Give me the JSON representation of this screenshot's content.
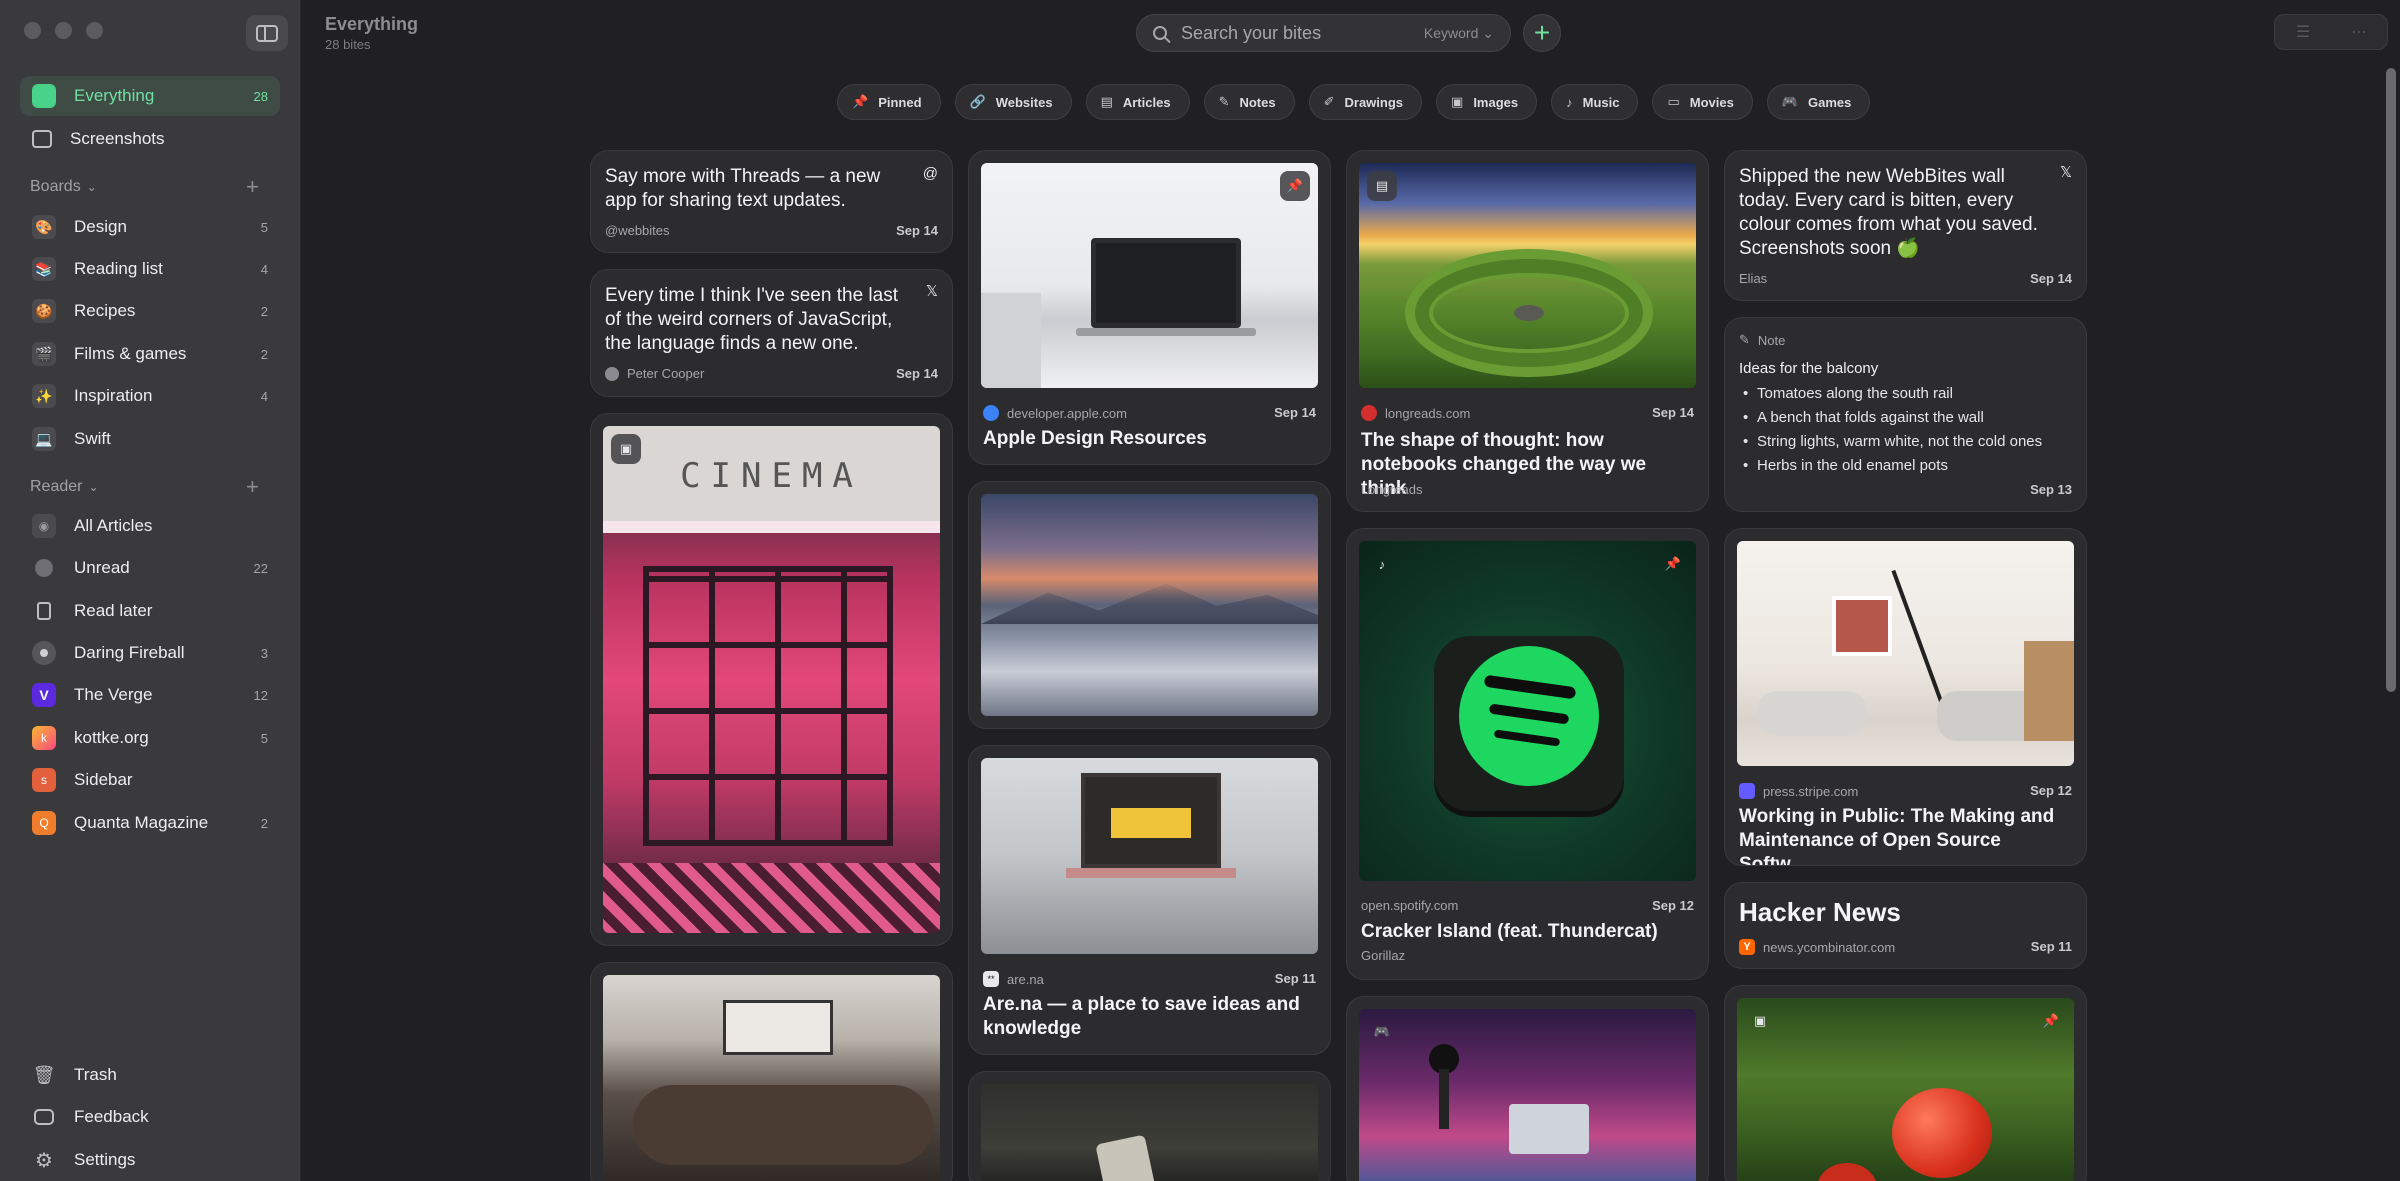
{
  "window": {
    "title": "Everything",
    "subtitle": "28 bites"
  },
  "search": {
    "placeholder": "Search your bites",
    "mode": "Keyword"
  },
  "toolbar": {
    "add_label": "+"
  },
  "sidebar": {
    "top": [
      {
        "label": "Everything",
        "count": "28",
        "icon": "everything-icon",
        "active": true
      },
      {
        "label": "Screenshots",
        "count": "",
        "icon": "screenshot-icon"
      }
    ],
    "boards_header": "Boards",
    "boards": [
      {
        "label": "Design",
        "count": "5",
        "icon": "palette-icon"
      },
      {
        "label": "Reading list",
        "count": "4",
        "icon": "books-icon"
      },
      {
        "label": "Recipes",
        "count": "2",
        "icon": "cookie-icon"
      },
      {
        "label": "Films & games",
        "count": "2",
        "icon": "film-icon"
      },
      {
        "label": "Inspiration",
        "count": "4",
        "icon": "sparkles-icon"
      },
      {
        "label": "Swift",
        "count": "",
        "icon": "laptop-icon"
      }
    ],
    "reader_header": "Reader",
    "reader": [
      {
        "label": "All Articles",
        "count": "",
        "icon": "rss-icon"
      },
      {
        "label": "Unread",
        "count": "22",
        "icon": "unread-dot-icon"
      },
      {
        "label": "Read later",
        "count": "",
        "icon": "bookmark-icon"
      },
      {
        "label": "Daring Fireball",
        "count": "3",
        "icon": "daring-fireball-icon"
      },
      {
        "label": "The Verge",
        "count": "12",
        "icon": "verge-icon"
      },
      {
        "label": "kottke.org",
        "count": "5",
        "icon": "kottke-icon"
      },
      {
        "label": "Sidebar",
        "count": "",
        "icon": "sidebar-feed-icon"
      },
      {
        "label": "Quanta Magazine",
        "count": "2",
        "icon": "quanta-icon"
      }
    ],
    "bottom": [
      {
        "label": "Trash",
        "icon": "trash-icon"
      },
      {
        "label": "Feedback",
        "icon": "feedback-icon"
      },
      {
        "label": "Settings",
        "icon": "gear-icon"
      }
    ]
  },
  "filters": [
    {
      "label": "Pinned",
      "icon": "pin-icon"
    },
    {
      "label": "Websites",
      "icon": "link-icon"
    },
    {
      "label": "Articles",
      "icon": "document-icon"
    },
    {
      "label": "Notes",
      "icon": "note-icon"
    },
    {
      "label": "Drawings",
      "icon": "pencil-icon"
    },
    {
      "label": "Images",
      "icon": "image-icon"
    },
    {
      "label": "Music",
      "icon": "music-icon"
    },
    {
      "label": "Movies",
      "icon": "film-icon"
    },
    {
      "label": "Games",
      "icon": "gamepad-icon"
    }
  ],
  "cards": {
    "threads": {
      "text": "Say more with Threads — a new app for sharing text updates.",
      "author": "@webbites",
      "date": "Sep 14",
      "icon": "threads-icon"
    },
    "tweet_js": {
      "text": "Every time I think I've seen the last of the weird corners of JavaScript, the language finds a new one.",
      "author": "Peter Cooper",
      "date": "Sep 14",
      "icon": "x-icon"
    },
    "cinema": {
      "sign": "CINEMA",
      "icon": "image-icon"
    },
    "apple": {
      "domain": "developer.apple.com",
      "date": "Sep 14",
      "title": "Apple Design Resources",
      "icon": "pin-icon"
    },
    "mountains": {
      "icon": "image-icon"
    },
    "arena": {
      "domain": "are.na",
      "date": "Sep 11",
      "title": "Are.na — a place to save ideas and knowledge"
    },
    "longreads": {
      "domain": "longreads.com",
      "date": "Sep 14",
      "title": "The shape of thought: how notebooks changed the way we think",
      "source": "Longreads",
      "icon": "article-icon"
    },
    "spotify": {
      "domain": "open.spotify.com",
      "date": "Sep 12",
      "title": "Cracker Island (feat. Thundercat)",
      "artist": "Gorillaz",
      "icon": "music-icon",
      "pin_icon": "pin-icon"
    },
    "game": {
      "icon": "gamepad-icon"
    },
    "tweet_wall": {
      "text": "Shipped the new WebBites wall today. Every card is bitten, every colour comes from what you saved. Screenshots soon 🍏",
      "author": "Elias",
      "date": "Sep 14",
      "icon": "x-icon"
    },
    "note": {
      "label": "Note",
      "heading": "Ideas for the balcony",
      "items": [
        "Tomatoes along the south rail",
        "A bench that folds against the wall",
        "String lights, warm white, not the cold ones",
        "Herbs in the old enamel pots"
      ],
      "date": "Sep 13"
    },
    "stripe": {
      "domain": "press.stripe.com",
      "date": "Sep 12",
      "title": "Working in Public: The Making and Maintenance of Open Source Softw..."
    },
    "hn": {
      "title": "Hacker News",
      "domain": "news.ycombinator.com",
      "date": "Sep 11"
    },
    "tomato": {
      "icon": "image-icon",
      "pin_icon": "pin-icon"
    }
  },
  "colors": {
    "accent": "#6fe0a0",
    "background": "#202022",
    "sidebar": "#3a3a3d"
  }
}
